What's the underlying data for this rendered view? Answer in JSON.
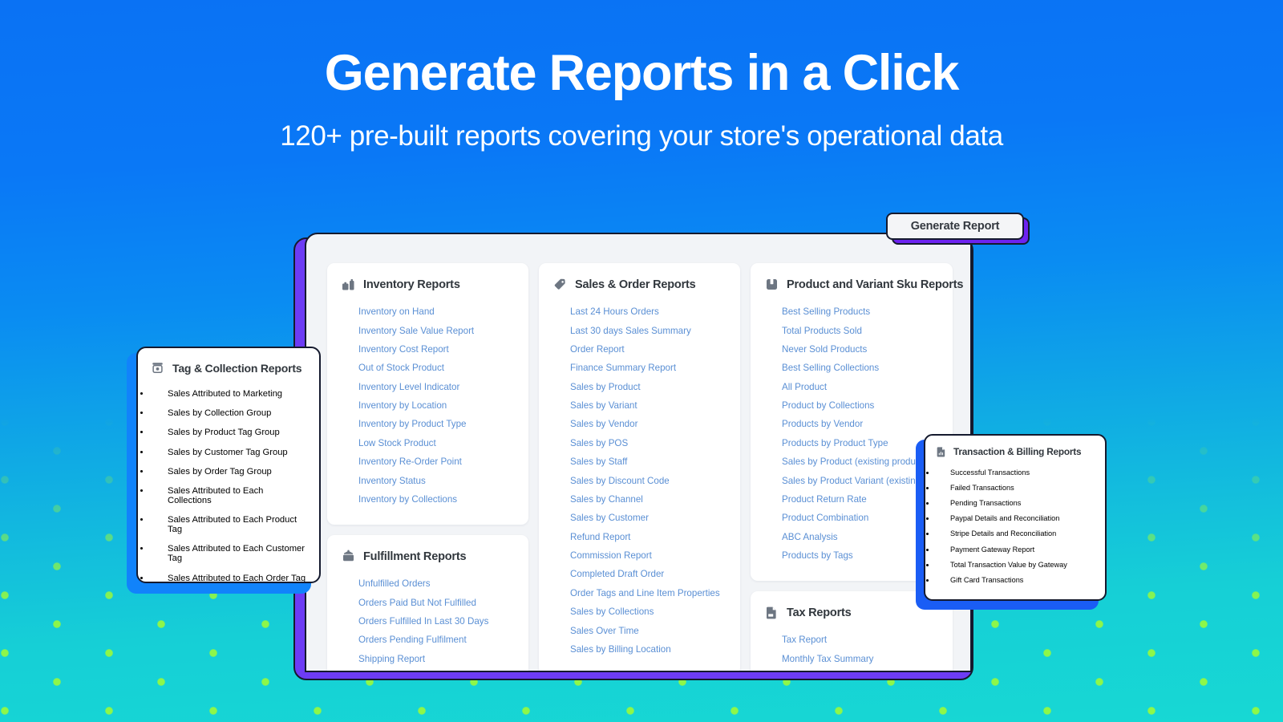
{
  "hero": {
    "title": "Generate Reports in a Click",
    "subtitle": "120+ pre-built reports covering your store's operational data"
  },
  "generate_button": {
    "label": "Generate Report",
    "icon": "none"
  },
  "colors": {
    "bg_top": "#0a72f4",
    "bg_bottom": "#17d8d4",
    "dot": "#aaff28",
    "link": "#5a8fd4",
    "heading": "#31373d",
    "panel_shadow_purple": "#6d3cf5",
    "tag_shadow_blue": "#1183fb",
    "txn_shadow_blue": "#1a5df5",
    "button_shadow_purple": "#6d23f0",
    "outline": "#151a2e"
  },
  "cards": {
    "inventory": {
      "title": "Inventory Reports",
      "icon": "boxes-icon",
      "items": [
        "Inventory on Hand",
        "Inventory Sale Value Report",
        "Inventory Cost Report",
        "Out of Stock Product",
        "Inventory Level Indicator",
        "Inventory by Location",
        "Inventory by Product Type",
        "Low Stock Product",
        "Inventory Re-Order Point",
        "Inventory Status",
        "Inventory by Collections"
      ]
    },
    "fulfillment": {
      "title": "Fulfillment Reports",
      "icon": "package-icon",
      "items": [
        "Unfulfilled Orders",
        "Orders Paid But Not Fulfilled",
        "Orders Fulfilled In Last 30 Days",
        "Orders Pending Fulfilment",
        "Shipping Report"
      ]
    },
    "sales_order": {
      "title": "Sales & Order Reports",
      "icon": "tag-icon",
      "items": [
        "Last 24 Hours Orders",
        "Last 30 days Sales Summary",
        "Order Report",
        "Finance Summary Report",
        "Sales by Product",
        "Sales by Variant",
        "Sales by Vendor",
        "Sales by POS",
        "Sales by Staff",
        "Sales by Discount Code",
        "Sales by Channel",
        "Sales by Customer",
        "Refund Report",
        "Commission Report",
        "Completed Draft Order",
        "Order Tags and Line Item Properties",
        "Sales by Collections",
        "Sales Over Time",
        "Sales by Billing Location"
      ]
    },
    "product_variant": {
      "title": "Product and Variant Sku Reports",
      "icon": "product-icon",
      "items": [
        "Best Selling Products",
        "Total Products Sold",
        "Never Sold Products",
        "Best Selling Collections",
        "All Product",
        "Product by Collections",
        "Products by Vendor",
        "Products by Product Type",
        "Sales by Product (existing products)",
        "Sales by Product Variant (existing skus)",
        "Product Return Rate",
        "Product Combination",
        "ABC Analysis",
        "Products by Tags"
      ]
    },
    "tax": {
      "title": "Tax Reports",
      "icon": "document-icon",
      "items": [
        "Tax Report",
        "Monthly Tax Summary"
      ]
    },
    "tag_collection": {
      "title": "Tag & Collection Reports",
      "icon": "tag-collection-icon",
      "items": [
        "Sales Attributed to Marketing",
        "Sales by Collection Group",
        "Sales by Product Tag Group",
        "Sales by Customer Tag Group",
        "Sales by Order Tag Group",
        "Sales Attributed to Each Collections",
        "Sales Attributed to Each Product Tag",
        "Sales Attributed to Each Customer Tag",
        "Sales Attributed to Each Order Tag"
      ]
    },
    "transaction_billing": {
      "title": "Transaction & Billing Reports",
      "icon": "receipt-icon",
      "items": [
        "Successful Transactions",
        "Failed Transactions",
        "Pending Transactions",
        "Paypal Details and Reconciliation",
        "Stripe Details and Reconciliation",
        "Payment Gateway Report",
        "Total Transaction Value by Gateway",
        "Gift Card Transactions"
      ]
    }
  }
}
